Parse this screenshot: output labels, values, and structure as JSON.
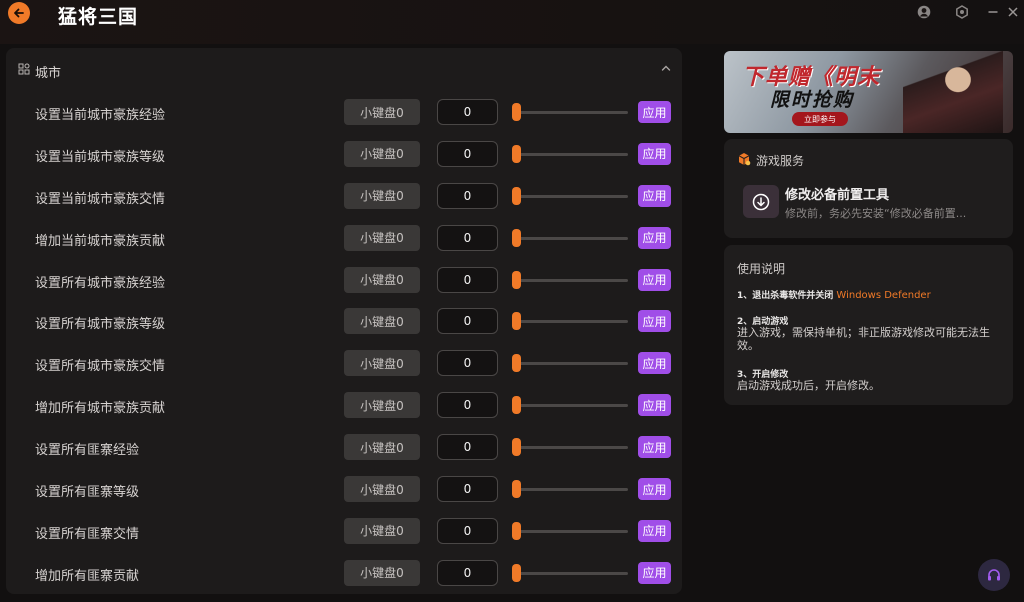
{
  "app": {
    "title": "猛将三国"
  },
  "panel": {
    "header_label": "城市",
    "rows": [
      {
        "label": "设置当前城市豪族经验",
        "keyboard": "小键盘0",
        "value": "0",
        "slider": 0,
        "apply": "应用"
      },
      {
        "label": "设置当前城市豪族等级",
        "keyboard": "小键盘0",
        "value": "0",
        "slider": 0,
        "apply": "应用"
      },
      {
        "label": "设置当前城市豪族交情",
        "keyboard": "小键盘0",
        "value": "0",
        "slider": 0,
        "apply": "应用"
      },
      {
        "label": "增加当前城市豪族贡献",
        "keyboard": "小键盘0",
        "value": "0",
        "slider": 0,
        "apply": "应用"
      },
      {
        "label": "设置所有城市豪族经验",
        "keyboard": "小键盘0",
        "value": "0",
        "slider": 0,
        "apply": "应用"
      },
      {
        "label": "设置所有城市豪族等级",
        "keyboard": "小键盘0",
        "value": "0",
        "slider": 0,
        "apply": "应用"
      },
      {
        "label": "设置所有城市豪族交情",
        "keyboard": "小键盘0",
        "value": "0",
        "slider": 0,
        "apply": "应用"
      },
      {
        "label": "增加所有城市豪族贡献",
        "keyboard": "小键盘0",
        "value": "0",
        "slider": 0,
        "apply": "应用"
      },
      {
        "label": "设置所有匪寨经验",
        "keyboard": "小键盘0",
        "value": "0",
        "slider": 0,
        "apply": "应用"
      },
      {
        "label": "设置所有匪寨等级",
        "keyboard": "小键盘0",
        "value": "0",
        "slider": 0,
        "apply": "应用"
      },
      {
        "label": "设置所有匪寨交情",
        "keyboard": "小键盘0",
        "value": "0",
        "slider": 0,
        "apply": "应用"
      },
      {
        "label": "增加所有匪寨贡献",
        "keyboard": "小键盘0",
        "value": "0",
        "slider": 0,
        "apply": "应用"
      }
    ]
  },
  "banner": {
    "headline": "下单赠《明末",
    "subline": "限时抢购",
    "cta": "立即参与"
  },
  "service": {
    "title": "游戏服务",
    "tool_name": "修改必备前置工具",
    "tool_desc": "修改前，务必先安装“修改必备前置..."
  },
  "usage": {
    "title": "使用说明",
    "step1_title": "1、退出杀毒软件并关闭",
    "step1_highlight": "Windows Defender",
    "step2_title": "2、启动游戏",
    "step2_text": "进入游戏，需保持单机；非正版游戏修改可能无法生效。",
    "step3_title": "3、开启修改",
    "step3_text": "启动游戏成功后，开启修改。"
  },
  "colors": {
    "accent": "#f07a28",
    "apply": "#a04ee8",
    "panel": "#1d1b1b",
    "background": "#121010"
  },
  "icons": {
    "back": "arrow-left-icon",
    "user": "user-icon",
    "settings": "hexagon-gear-icon",
    "minimize": "minimize-icon",
    "close": "close-icon",
    "section": "city-grid-icon",
    "collapse": "chevron-up-icon",
    "service": "cube-icon",
    "tool": "download-circle-icon",
    "support": "headset-icon"
  }
}
